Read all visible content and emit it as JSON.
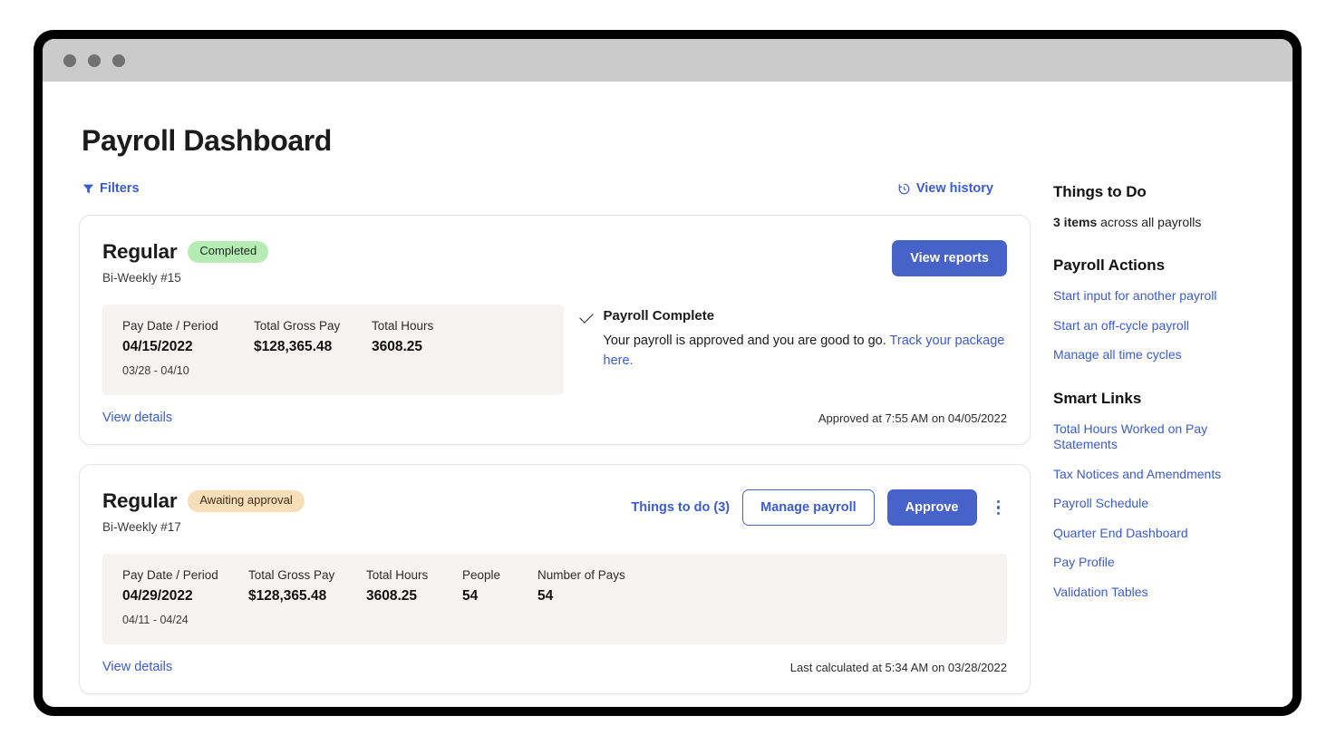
{
  "window": {
    "traffic_lights": [
      "close",
      "minimize",
      "zoom"
    ]
  },
  "header": {
    "title": "Payroll Dashboard"
  },
  "toolbar": {
    "filters_label": "Filters",
    "filters_icon": "funnel-icon",
    "view_history_label": "View history",
    "view_history_icon": "history-clock-icon"
  },
  "colors": {
    "accent_blue": "#3b5bd4",
    "button_blue": "#4763ca",
    "badge_completed_bg": "#b4ecb4",
    "badge_awaiting_bg": "#f6deb8",
    "stats_bg": "#f5f4f2",
    "titlebar_gray": "#cbcbcb"
  },
  "payrolls": [
    {
      "title": "Regular",
      "badge": "Completed",
      "subtitle": "Bi-Weekly #15",
      "primary_action": "View reports",
      "stats": [
        {
          "label": "Pay Date / Period",
          "value": "04/15/2022",
          "sub": "03/28 - 04/10"
        },
        {
          "label": "Total Gross Pay",
          "value": "$128,365.48",
          "sub": ""
        },
        {
          "label": "Total Hours",
          "value": "3608.25",
          "sub": ""
        }
      ],
      "status": {
        "icon": "check-icon",
        "title": "Payroll Complete",
        "text": "Your payroll is approved and you are good to go. ",
        "link_text": "Track your package here."
      },
      "footer_link": "View details",
      "footer_note": "Approved at 7:55 AM on 04/05/2022"
    },
    {
      "title": "Regular",
      "badge": "Awaiting approval",
      "subtitle": "Bi-Weekly #17",
      "things_to_do": "Things to do (3)",
      "secondary_action": "Manage payroll",
      "primary_action": "Approve",
      "overflow_icon": "kebab-menu-icon",
      "stats": [
        {
          "label": "Pay Date / Period",
          "value": "04/29/2022",
          "sub": "04/11 - 04/24"
        },
        {
          "label": "Total Gross Pay",
          "value": "$128,365.48",
          "sub": ""
        },
        {
          "label": "Total Hours",
          "value": "3608.25",
          "sub": ""
        },
        {
          "label": "People",
          "value": "54",
          "sub": ""
        },
        {
          "label": "Number of Pays",
          "value": "54",
          "sub": ""
        }
      ],
      "footer_link": "View details",
      "footer_note": "Last calculated at 5:34 AM on 03/28/2022"
    }
  ],
  "sidebar": {
    "things_to_do_title": "Things to Do",
    "things_to_do_count": "3 items",
    "things_to_do_rest": " across all payrolls",
    "payroll_actions_title": "Payroll Actions",
    "payroll_actions": [
      "Start input for another payroll",
      "Start an off-cycle payroll",
      "Manage all time cycles"
    ],
    "smart_links_title": "Smart Links",
    "smart_links": [
      "Total Hours Worked on Pay Statements",
      "Tax Notices and Amendments",
      "Payroll Schedule",
      "Quarter End Dashboard",
      "Pay Profile",
      "Validation Tables"
    ]
  }
}
